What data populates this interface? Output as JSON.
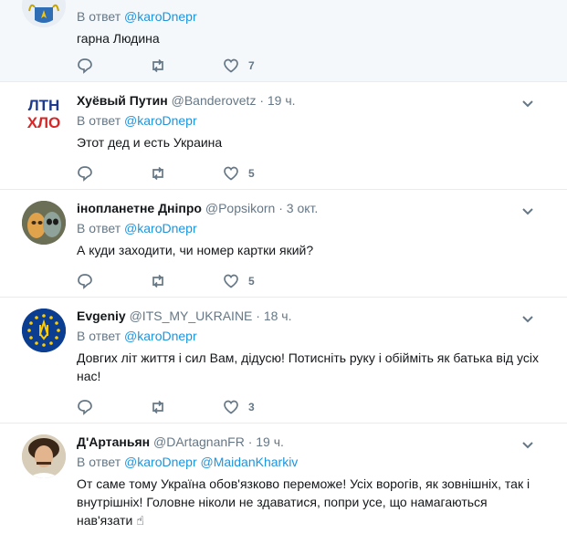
{
  "reply_prefix": "В ответ",
  "tweets": [
    {
      "fullname": "",
      "username": "",
      "time": "",
      "reply_to": [
        "@karoDnepr"
      ],
      "text": "гарна Людина",
      "likes": "7"
    },
    {
      "fullname": "Хуёвый Путин",
      "username": "@Banderovetz",
      "time": "· 19 ч.",
      "reply_to": [
        "@karoDnepr"
      ],
      "text": "Этот дед и есть Украина",
      "likes": "5",
      "avatar_text_top": "ЛТН",
      "avatar_text_bottom": "ХЛО"
    },
    {
      "fullname": "інопланетне Дніпро",
      "username": "@Popsikorn",
      "time": "· 3 окт.",
      "reply_to": [
        "@karoDnepr"
      ],
      "text": "А куди заходити, чи номер картки який?",
      "likes": "5"
    },
    {
      "fullname": "Evgeniy",
      "username": "@ITS_MY_UKRAINE",
      "time": "· 18 ч.",
      "reply_to": [
        "@karoDnepr"
      ],
      "text": "Довгих літ життя і сил Вам, дідусю! Потисніть руку і обійміть як батька від усіх нас!",
      "likes": "3"
    },
    {
      "fullname": "Д'Артаньян",
      "username": "@DArtagnanFR",
      "time": "· 19 ч.",
      "reply_to": [
        "@karoDnepr",
        "@MaidanKharkiv"
      ],
      "text": "От саме тому Україна обов'язково переможе! Усіх ворогів, як зовнішніх, так і внутрішніх! Головне ніколи не здаватися, попри усе, що намагаються нав'язати ☝"
    }
  ],
  "colors": {
    "link": "#1b95e0",
    "secondary": "#657786",
    "border": "#e6ecf0",
    "highlight_bg": "#f5f8fa"
  }
}
